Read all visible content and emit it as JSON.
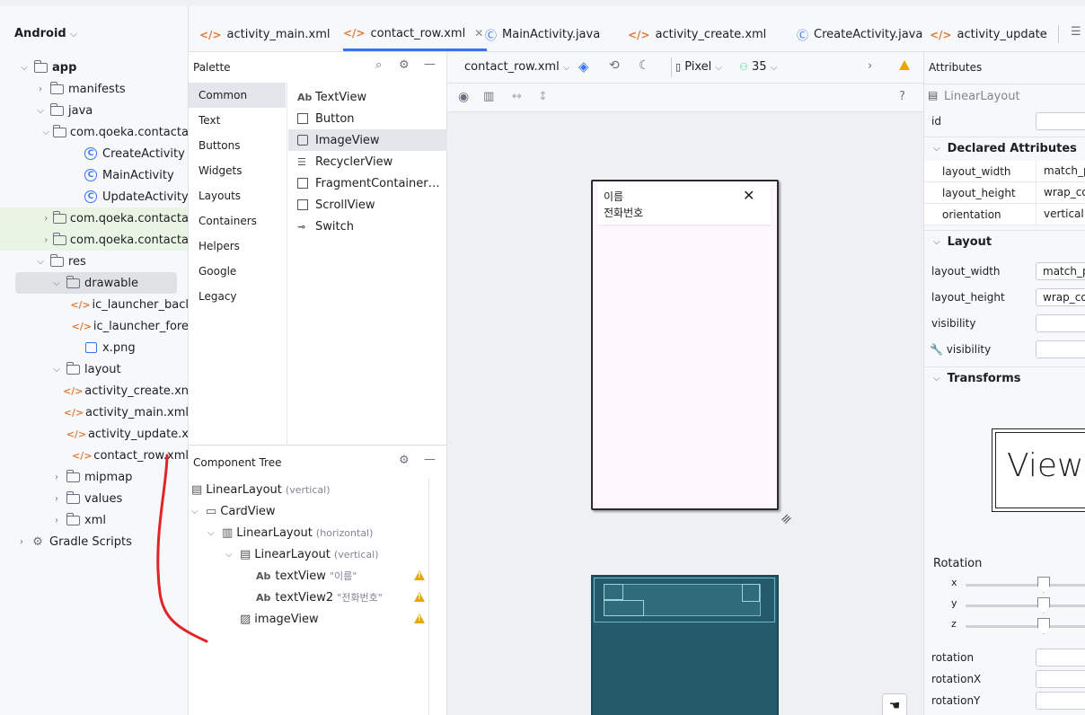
{
  "project": {
    "title": "Android",
    "items": [
      {
        "label": "app",
        "bold": true
      },
      {
        "label": "manifests"
      },
      {
        "label": "java"
      },
      {
        "label": "com.qoeka.contacta"
      },
      {
        "label": "CreateActivity"
      },
      {
        "label": "MainActivity"
      },
      {
        "label": "UpdateActivity"
      },
      {
        "label": "com.qoeka.contacta"
      },
      {
        "label": "com.qoeka.contacta"
      },
      {
        "label": "res"
      },
      {
        "label": "drawable"
      },
      {
        "label": "ic_launcher_bacl"
      },
      {
        "label": "ic_launcher_fore"
      },
      {
        "label": "x.png"
      },
      {
        "label": "layout"
      },
      {
        "label": "activity_create.xn"
      },
      {
        "label": "activity_main.xml"
      },
      {
        "label": "activity_update.x"
      },
      {
        "label": "contact_row.xml"
      },
      {
        "label": "mipmap"
      },
      {
        "label": "values"
      },
      {
        "label": "xml"
      },
      {
        "label": "Gradle Scripts"
      }
    ]
  },
  "tabs": [
    {
      "label": "activity_main.xml",
      "kind": "xml"
    },
    {
      "label": "contact_row.xml",
      "kind": "xml",
      "active": true
    },
    {
      "label": "MainActivity.java",
      "kind": "class"
    },
    {
      "label": "activity_create.xml",
      "kind": "xml"
    },
    {
      "label": "CreateActivity.java",
      "kind": "class"
    },
    {
      "label": "activity_update",
      "kind": "xml"
    }
  ],
  "palette": {
    "title": "Palette",
    "categories": [
      "Common",
      "Text",
      "Buttons",
      "Widgets",
      "Layouts",
      "Containers",
      "Helpers",
      "Google",
      "Legacy"
    ],
    "items": [
      {
        "label": "TextView",
        "icon": "Ab"
      },
      {
        "label": "Button",
        "icon": "square"
      },
      {
        "label": "ImageView",
        "icon": "image"
      },
      {
        "label": "RecyclerView",
        "icon": "list"
      },
      {
        "label": "FragmentContainer…",
        "icon": "square"
      },
      {
        "label": "ScrollView",
        "icon": "square"
      },
      {
        "label": "Switch",
        "icon": "switch"
      }
    ]
  },
  "component_tree": {
    "title": "Component Tree",
    "rows": [
      {
        "label": "LinearLayout",
        "meta": "(vertical)"
      },
      {
        "label": "CardView",
        "meta": ""
      },
      {
        "label": "LinearLayout",
        "meta": "(horizontal)"
      },
      {
        "label": "LinearLayout",
        "meta": "(vertical)"
      },
      {
        "label": "textView",
        "meta": "\"이름\""
      },
      {
        "label": "textView2",
        "meta": "\"전화번호\""
      },
      {
        "label": "imageView",
        "meta": ""
      }
    ]
  },
  "design": {
    "file_selector": "contact_row.xml",
    "device": "Pixel",
    "api": "35",
    "help": "?",
    "card_name": "이름",
    "card_phone": "전화번호",
    "close_glyph": "✕"
  },
  "attributes": {
    "title": "Attributes",
    "component": "LinearLayout",
    "id_label": "id",
    "declared_title": "Declared Attributes",
    "declared": [
      {
        "key": "layout_width",
        "value": "match_p"
      },
      {
        "key": "layout_height",
        "value": "wrap_co"
      },
      {
        "key": "orientation",
        "value": "vertical"
      }
    ],
    "layout_title": "Layout",
    "layout": [
      {
        "key": "layout_width",
        "value": "match_p"
      },
      {
        "key": "layout_height",
        "value": "wrap_co"
      },
      {
        "key": "visibility",
        "value": ""
      },
      {
        "key": "visibility",
        "value": ""
      }
    ],
    "transforms_title": "Transforms",
    "preview_label": "View",
    "rotation_title": "Rotation",
    "axes": [
      "x",
      "y",
      "z"
    ],
    "rotation_fields": [
      "rotation",
      "rotationX",
      "rotationY"
    ]
  },
  "colors": {
    "accent": "#3574f0",
    "warning": "#e6a700",
    "blueprint": "#235b6b",
    "annotation": "#e0242a"
  }
}
